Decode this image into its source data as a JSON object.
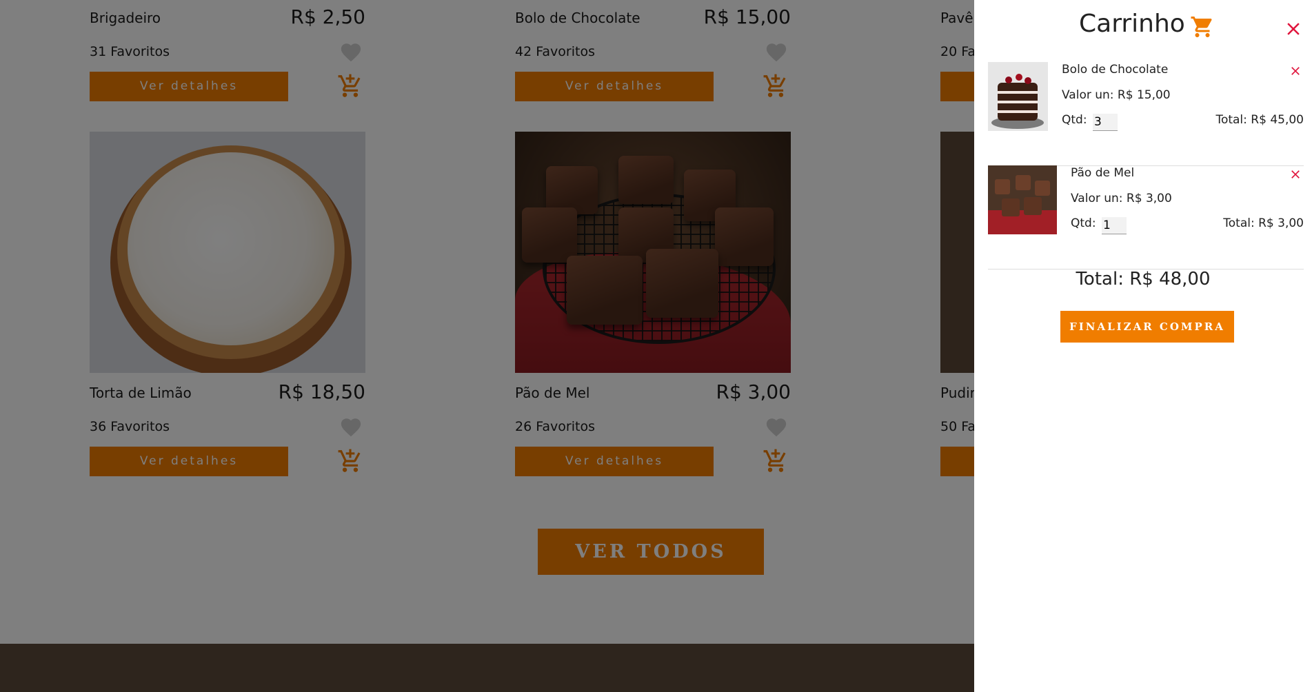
{
  "colors": {
    "accent": "#f07d00",
    "remove": "#e0143c",
    "footer": "#5c4a3a",
    "heart": "#cfcfcf"
  },
  "icons": {
    "favorite": "heart-icon",
    "add_to_cart": "cart-plus-icon",
    "cart": "shopping-cart-icon",
    "close": "close-icon"
  },
  "products": [
    {
      "name": "Brigadeiro",
      "price": "R$ 2,50",
      "favorites": "31 Favoritos",
      "details": "Ver detalhes"
    },
    {
      "name": "Bolo de Chocolate",
      "price": "R$ 15,00",
      "favorites": "42 Favoritos",
      "details": "Ver detalhes"
    },
    {
      "name": "Pavê",
      "favorites": "20 Fa"
    },
    {
      "name": "Torta de Limão",
      "price": "R$ 18,50",
      "favorites": "36 Favoritos",
      "details": "Ver detalhes"
    },
    {
      "name": "Pão de Mel",
      "price": "R$ 3,00",
      "favorites": "26 Favoritos",
      "details": "Ver detalhes"
    },
    {
      "name": "Pudir",
      "favorites": "50 Fa"
    }
  ],
  "ver_todos": "VER TODOS",
  "cart": {
    "title": "Carrinho",
    "items": [
      {
        "name": "Bolo de Chocolate",
        "unit": "Valor un: R$ 15,00",
        "qty_label": "Qtd:",
        "qty": "3",
        "total": "Total: R$ 45,00"
      },
      {
        "name": "Pão de Mel",
        "unit": "Valor un: R$ 3,00",
        "qty_label": "Qtd:",
        "qty": "1",
        "total": "Total: R$ 3,00"
      }
    ],
    "total": "Total: R$ 48,00",
    "checkout": "FINALIZAR COMPRA"
  }
}
